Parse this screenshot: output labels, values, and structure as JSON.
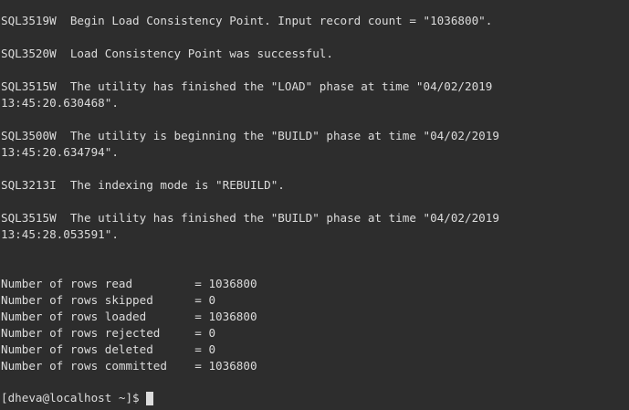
{
  "terminal": {
    "background": "#2d2d2d",
    "foreground": "#dcdcdc",
    "lines": [
      "SQL3519W  Begin Load Consistency Point. Input record count = \"1036800\".",
      "",
      "SQL3520W  Load Consistency Point was successful.",
      "",
      "SQL3515W  The utility has finished the \"LOAD\" phase at time \"04/02/2019",
      "13:45:20.630468\".",
      "",
      "SQL3500W  The utility is beginning the \"BUILD\" phase at time \"04/02/2019",
      "13:45:20.634794\".",
      "",
      "SQL3213I  The indexing mode is \"REBUILD\".",
      "",
      "SQL3515W  The utility has finished the \"BUILD\" phase at time \"04/02/2019",
      "13:45:28.053591\".",
      "",
      "",
      "Number of rows read         = 1036800",
      "Number of rows skipped      = 0",
      "Number of rows loaded       = 1036800",
      "Number of rows rejected     = 0",
      "Number of rows deleted      = 0",
      "Number of rows committed    = 1036800"
    ],
    "prompt": "[dheva@localhost ~]$ "
  }
}
